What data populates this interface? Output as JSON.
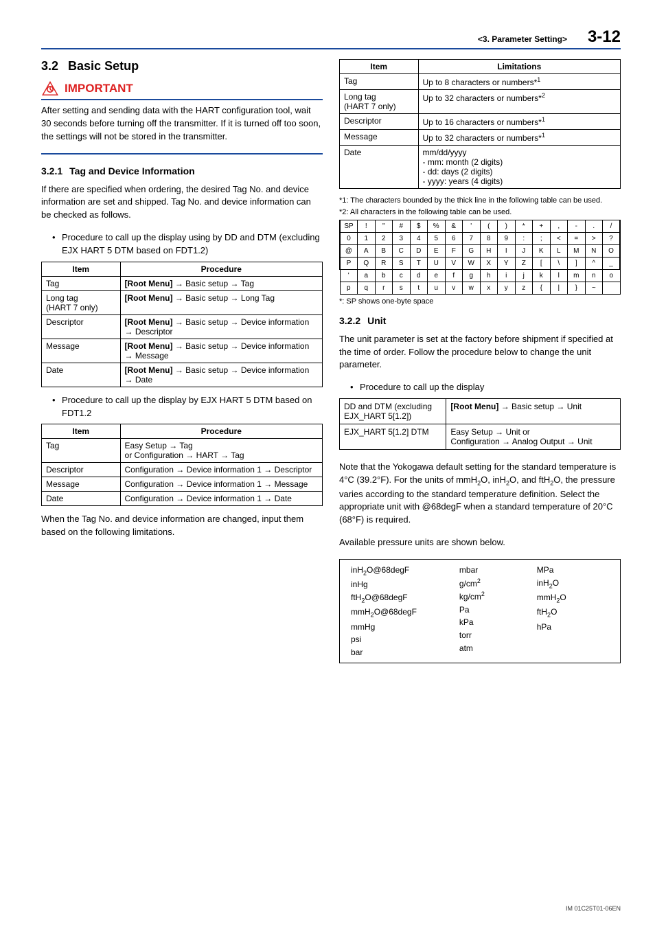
{
  "header": {
    "section": "<3.  Parameter Setting>",
    "page": "3-12"
  },
  "left": {
    "h2_num": "3.2",
    "h2_txt": "Basic Setup",
    "important": "IMPORTANT",
    "imp_para": "After setting and sending data with the HART configuration tool, wait 30 seconds before turning off the transmitter. If it is turned off too soon, the settings will not be stored in the transmitter.",
    "h3a_num": "3.2.1",
    "h3a_txt": "Tag and Device Information",
    "para1": "If there are specified when ordering, the desired Tag No. and device information are set and shipped. Tag No. and device information can be checked as follows.",
    "bul1": "Procedure to call up the display using by DD and DTM (excluding EJX HART 5 DTM based on FDT1.2)",
    "tbl1": {
      "h1": "Item",
      "h2": "Procedure",
      "rows": [
        {
          "a": "Tag",
          "b": "[Root Menu] → Basic setup → Tag"
        },
        {
          "a": "Long tag\n(HART 7 only)",
          "b": "[Root Menu] → Basic setup → Long Tag"
        },
        {
          "a": "Descriptor",
          "b": "[Root Menu] → Basic setup → Device information → Descriptor"
        },
        {
          "a": "Message",
          "b": "[Root Menu] → Basic setup → Device information → Message"
        },
        {
          "a": "Date",
          "b": "[Root Menu] → Basic setup → Device information → Date"
        }
      ]
    },
    "bul2": "Procedure to call up the display by EJX HART 5 DTM based on FDT1.2",
    "tbl2": {
      "h1": "Item",
      "h2": "Procedure",
      "rows": [
        {
          "a": "Tag",
          "b": "Easy Setup → Tag\nor Configuration → HART → Tag"
        },
        {
          "a": "Descriptor",
          "b": "Configuration → Device information 1 → Descriptor"
        },
        {
          "a": "Message",
          "b": "Configuration → Device information 1 → Message"
        },
        {
          "a": "Date",
          "b": "Configuration → Device information 1 → Date"
        }
      ]
    },
    "para2": "When the Tag No. and device information are changed, input them based on the following limitations."
  },
  "right": {
    "tbl3": {
      "h1": "Item",
      "h2": "Limitations",
      "rows": [
        {
          "a": "Tag",
          "b": "Up to 8 characters or numbers*1"
        },
        {
          "a": "Long tag\n(HART 7 only)",
          "b": "Up to 32 characters or numbers*2"
        },
        {
          "a": "Descriptor",
          "b": "Up to 16 characters or numbers*1"
        },
        {
          "a": "Message",
          "b": "Up to 32 characters or numbers*1"
        },
        {
          "a": "Date",
          "b": "mm/dd/yyyy\n- mm: month (2 digits)\n- dd: days (2 digits)\n- yyyy: years (4 digits)"
        }
      ]
    },
    "note1": "*1:    The characters bounded by the thick line in the following table can be used.",
    "note2": "*2:    All characters in the following table can be used.",
    "chart_data": {
      "type": "table",
      "title": "HART character set (6 rows × 16 columns)",
      "rows": [
        [
          "SP",
          "!",
          "\"",
          "#",
          "$",
          "%",
          "&",
          "'",
          "(",
          ")",
          "*",
          "+",
          ",",
          "-",
          ".",
          "/"
        ],
        [
          "0",
          "1",
          "2",
          "3",
          "4",
          "5",
          "6",
          "7",
          "8",
          "9",
          ":",
          ";",
          "<",
          "=",
          ">",
          "?"
        ],
        [
          "@",
          "A",
          "B",
          "C",
          "D",
          "E",
          "F",
          "G",
          "H",
          "I",
          "J",
          "K",
          "L",
          "M",
          "N",
          "O"
        ],
        [
          "P",
          "Q",
          "R",
          "S",
          "T",
          "U",
          "V",
          "W",
          "X",
          "Y",
          "Z",
          "[",
          "\\",
          "]",
          "^",
          "_"
        ],
        [
          "'",
          "a",
          "b",
          "c",
          "d",
          "e",
          "f",
          "g",
          "h",
          "i",
          "j",
          "k",
          "l",
          "m",
          "n",
          "o"
        ],
        [
          "p",
          "q",
          "r",
          "s",
          "t",
          "u",
          "v",
          "w",
          "x",
          "y",
          "z",
          "{",
          "|",
          "}",
          "~",
          ""
        ]
      ],
      "thick_box_rows": [
        0,
        1,
        2,
        3
      ]
    },
    "spnote": "*: SP shows one-byte space",
    "h3b_num": "3.2.2",
    "h3b_txt": "Unit",
    "para3": "The unit parameter is set at the factory before shipment if specified at the time of order. Follow the procedure below to change the unit parameter.",
    "bul3": "Procedure to call up the display",
    "unittbl": {
      "r1a": "DD and DTM (excluding EJX_HART 5[1.2])",
      "r1b": "[Root Menu] → Basic setup → Unit",
      "r2a": "EJX_HART 5[1.2] DTM",
      "r2b": "Easy Setup → Unit or\nConfiguration → Analog Output → Unit"
    },
    "para4a": "Note that the Yokogawa default setting for the standard temperature is 4°C (39.2°F). For the units of mmH",
    "para4b": "O, inH",
    "para4c": "O, and ftH",
    "para4d": "O, the pressure varies according to the standard temperature definition. Select the appropriate unit with @68degF when a standard temperature of 20°C (68°F) is required.",
    "para5": "Available pressure units are shown below.",
    "ptbl": {
      "c1": [
        "inH2O@68degF",
        "inHg",
        "ftH2O@68degF",
        "mmH2O@68degF",
        "mmHg",
        "psi",
        "bar"
      ],
      "c2": [
        "mbar",
        "g/cm2",
        "kg/cm2",
        "Pa",
        "kPa",
        "torr",
        "atm"
      ],
      "c3": [
        "MPa",
        "inH2O",
        "mmH2O",
        "ftH2O",
        "hPa"
      ]
    }
  },
  "footer": "IM 01C25T01-06EN"
}
